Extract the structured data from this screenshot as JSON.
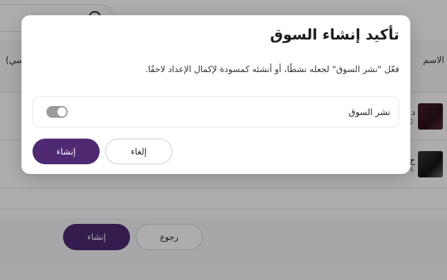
{
  "background": {
    "columns": {
      "name": "الاسم",
      "left_partial": "سي)"
    },
    "rows": [
      {
        "title_partial": "د",
        "sub_partial": "2"
      },
      {
        "title_partial": "ح",
        "sub_partial": "4"
      }
    ],
    "footer": {
      "create_label": "إنشاء",
      "back_label": "رجوع"
    }
  },
  "modal": {
    "title": "تأكيد إنشاء السوق",
    "description": "فعّل \"نشر السوق\" لجعله نشطًا، أو أنشئه كمسودة لإكمال الإعداد لاحقًا.",
    "toggle": {
      "label": "نشر السوق",
      "state": "on"
    },
    "buttons": {
      "confirm_label": "إنشاء",
      "cancel_label": "إلغاء"
    }
  },
  "colors": {
    "primary": "#4f2a73",
    "toggle": "#9a9a9f"
  }
}
